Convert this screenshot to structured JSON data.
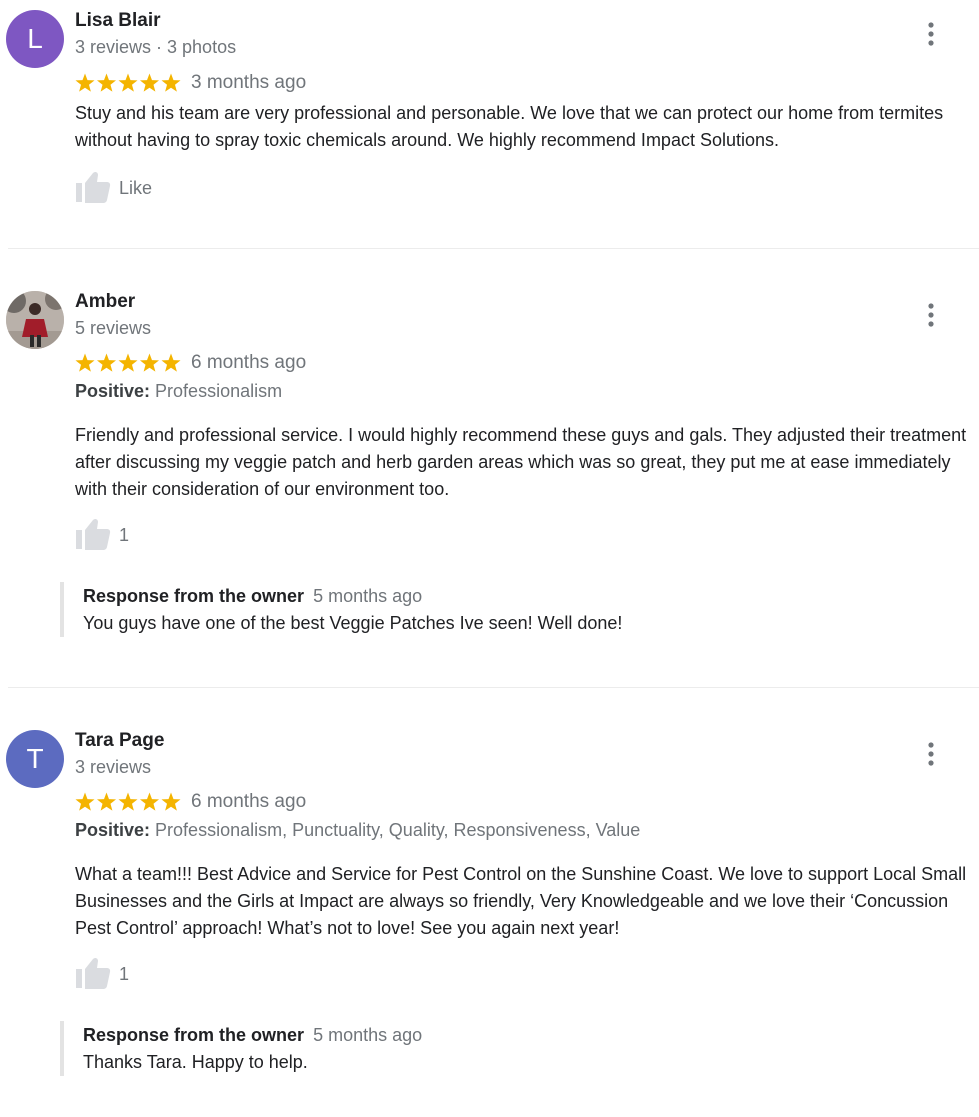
{
  "colors": {
    "star": "#f4b400",
    "avatar_l": "#7e57c2",
    "avatar_t": "#5c6bc0",
    "muted": "#70757a"
  },
  "icons": {
    "more": "more-vert-icon",
    "like": "thumb-up-icon",
    "star": "star-icon"
  },
  "reviews": [
    {
      "initial": "L",
      "name": "Lisa Blair",
      "meta": "3 reviews · 3 photos",
      "rating": 5,
      "time": "3 months ago",
      "text": "Stuy and his team are very professional and personable.  We love that we can protect our home from termites without having to spray toxic chemicals around.   We highly recommend Impact Solutions.",
      "like_label": "Like"
    },
    {
      "name": "Amber",
      "meta": "5 reviews",
      "rating": 5,
      "time": "6 months ago",
      "positive_label": "Positive:",
      "positive_value": "Professionalism",
      "text": "Friendly and professional service. I would highly recommend these guys and gals. They adjusted their treatment after discussing my veggie patch and herb garden areas which was so great, they put me at ease immediately with their consideration of our environment too.",
      "like_label": "1",
      "owner_label": "Response from the owner",
      "owner_time": "5 months ago",
      "owner_text": "You guys have one of the best Veggie Patches Ive seen! Well done!"
    },
    {
      "initial": "T",
      "name": "Tara Page",
      "meta": "3 reviews",
      "rating": 5,
      "time": "6 months ago",
      "positive_label": "Positive:",
      "positive_value": "Professionalism, Punctuality, Quality, Responsiveness, Value",
      "text": "What a team!!! Best Advice and Service for Pest Control on the Sunshine Coast. We love to support Local Small Businesses and the Girls at Impact are always so friendly, Very Knowledgeable and we love their ‘Concussion Pest Control’ approach! What’s not to love! See you again next year!",
      "like_label": "1",
      "owner_label": "Response from the owner",
      "owner_time": "5 months ago",
      "owner_text": "Thanks Tara. Happy to help."
    }
  ]
}
